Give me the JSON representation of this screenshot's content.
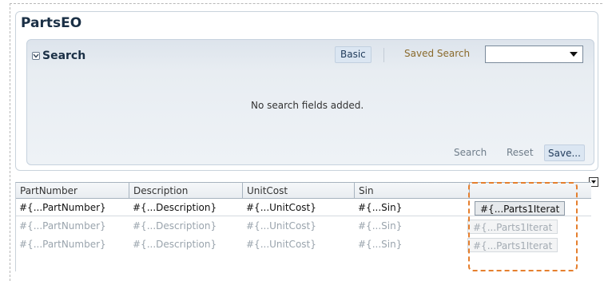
{
  "panel": {
    "title": "PartsEO"
  },
  "search": {
    "disclosure_label": "Search",
    "basic_label": "Basic",
    "saved_search_label": "Saved Search",
    "saved_search_value": "",
    "empty_message": "No search fields added.",
    "buttons": {
      "search": "Search",
      "reset": "Reset",
      "save": "Save..."
    }
  },
  "table": {
    "columns": [
      "PartNumber",
      "Description",
      "UnitCost",
      "Sin",
      ""
    ],
    "rows": [
      [
        "#{...PartNumber}",
        "#{...Description}",
        "#{...UnitCost}",
        "#{...Sin}",
        "#{...Parts1Iterat"
      ],
      [
        "#{...PartNumber}",
        "#{...Description}",
        "#{...UnitCost}",
        "#{...Sin}",
        "#{...Parts1Iterat"
      ],
      [
        "#{...PartNumber}",
        "#{...Description}",
        "#{...UnitCost}",
        "#{...Sin}",
        "#{...Parts1Iterat"
      ]
    ]
  },
  "colors": {
    "title": "#1a2f45",
    "saved_label": "#8a6a2c",
    "highlight": "#e57f2e"
  },
  "icons": {
    "disclosure": "chevron-down-icon",
    "table_menu": "dropdown-icon",
    "select_arrow": "dropdown-arrow-icon"
  }
}
